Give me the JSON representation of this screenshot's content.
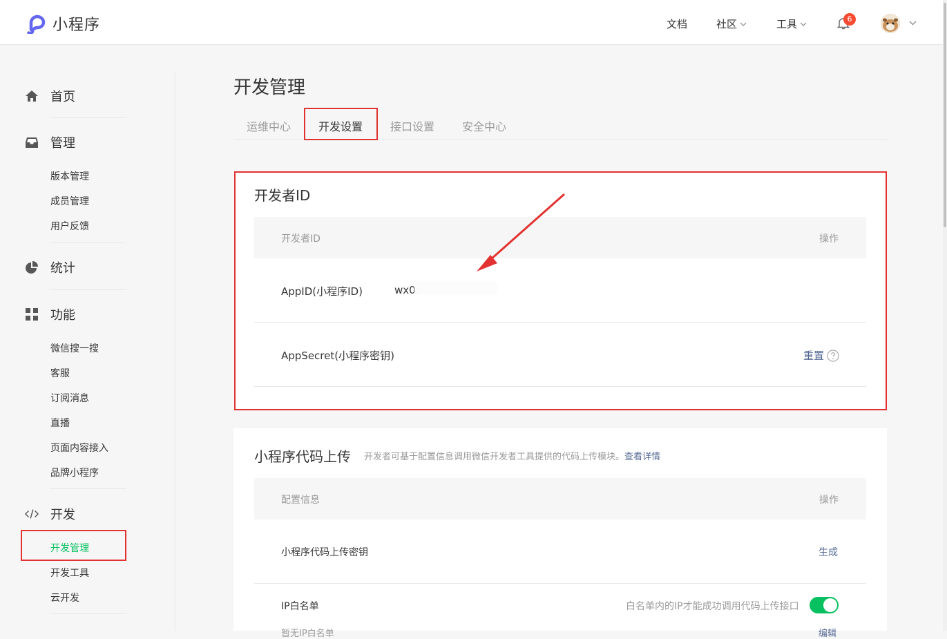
{
  "header": {
    "logo_text": "小程序",
    "nav": {
      "docs": "文档",
      "community": "社区",
      "tools": "工具"
    },
    "notification_count": "6"
  },
  "sidebar": {
    "groups": {
      "home": "首页",
      "manage": "管理",
      "stats": "统计",
      "features": "功能",
      "dev": "开发"
    },
    "manage_items": [
      "版本管理",
      "成员管理",
      "用户反馈"
    ],
    "feature_items": [
      "微信搜一搜",
      "客服",
      "订阅消息",
      "直播",
      "页面内容接入",
      "品牌小程序"
    ],
    "dev_items": [
      "开发管理",
      "开发工具",
      "云开发"
    ]
  },
  "main": {
    "title": "开发管理",
    "tabs": [
      "运维中心",
      "开发设置",
      "接口设置",
      "安全中心"
    ],
    "dev_id_card": {
      "title": "开发者ID",
      "col_left": "开发者ID",
      "col_right": "操作",
      "rows": {
        "appid_label": "AppID(小程序ID)",
        "appid_value": "wx0.",
        "secret_label": "AppSecret(小程序密钥)",
        "secret_action": "重置"
      }
    },
    "upload_card": {
      "title": "小程序代码上传",
      "desc": "开发者可基于配置信息调用微信开发者工具提供的代码上传模块。",
      "desc_link": "查看详情",
      "col_left": "配置信息",
      "col_right": "操作",
      "key_label": "小程序代码上传密钥",
      "key_action": "生成",
      "ip_label": "IP白名单",
      "ip_hint": "白名单内的IP才能成功调用代码上传接口",
      "ip_sub": "暂无IP白名单",
      "ip_action": "编辑"
    }
  },
  "colors": {
    "accent_green": "#07c160",
    "link_blue": "#576b95",
    "highlight_red": "#e33232",
    "badge_red": "#f74c31"
  }
}
